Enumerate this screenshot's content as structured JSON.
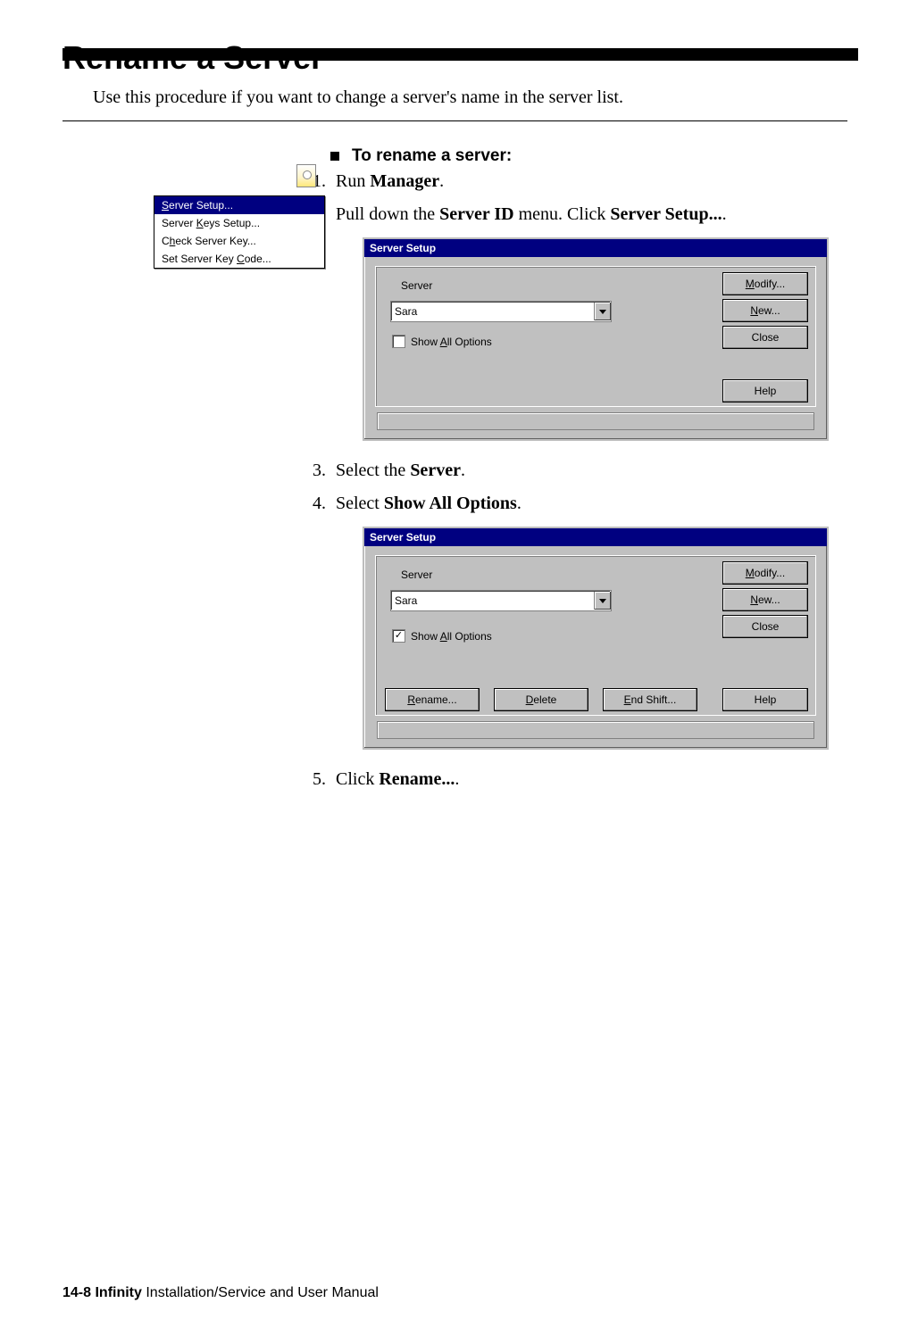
{
  "page": {
    "heading": "Rename a Server",
    "intro": "Use this procedure if you want to change a server's name in the server list.",
    "lead": "To rename a server:"
  },
  "menu": {
    "items": [
      "Server Setup...",
      "Server Keys Setup...",
      "Check Server Key...",
      "Set Server Key Code..."
    ],
    "selected_index": 0
  },
  "steps": {
    "s1_pre": "Run ",
    "s1_b": "Manager",
    "s1_post": ".",
    "s2_pre": "Pull down the ",
    "s2_b1": "Server ID",
    "s2_mid": " menu. Click ",
    "s2_b2": "Server Setup...",
    "s2_post": ".",
    "s3_pre": "Select the ",
    "s3_b": "Server",
    "s3_post": ".",
    "s4_pre": "Select ",
    "s4_b": "Show All Options",
    "s4_post": ".",
    "s5_pre": "Click ",
    "s5_b": "Rename...",
    "s5_post": "."
  },
  "dialog": {
    "title": "Server Setup",
    "server_label": "Server",
    "server_value": "Sara",
    "show_all_label_pre": "Show ",
    "show_all_label_u": "A",
    "show_all_label_post": "ll Options",
    "buttons": {
      "modify_u": "M",
      "modify": "odify...",
      "new_u": "N",
      "new": "ew...",
      "close": "Close",
      "help": "Help",
      "rename_u": "R",
      "rename": "ename...",
      "delete_u": "D",
      "delete": "elete",
      "end_u": "E",
      "end": "nd Shift..."
    }
  },
  "footer": {
    "page_no": "14-8  ",
    "title_b": "Infinity",
    "title_rest": " Installation/Service and User Manual"
  }
}
